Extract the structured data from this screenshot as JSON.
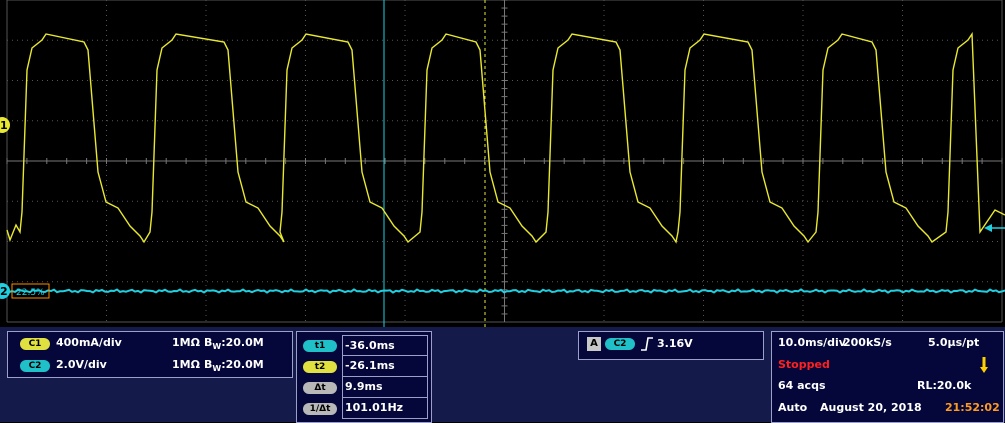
{
  "colors": {
    "ch1": "#e8e830",
    "ch2": "#20d0e0",
    "grid": "#555555",
    "trigger_marker": "#ff8c00",
    "stopped": "#ff2020",
    "time": "#ff9a20"
  },
  "channels": [
    {
      "badge": "C1",
      "scale": "400mA/div",
      "impedance": "1MΩ",
      "bw_prefix": "B",
      "bw_sub": "W",
      "bw_value": ":20.0M"
    },
    {
      "badge": "C2",
      "scale": "2.0V/div",
      "impedance": "1MΩ",
      "bw_prefix": "B",
      "bw_sub": "W",
      "bw_value": ":20.0M"
    }
  ],
  "cursors": [
    {
      "label": "t1",
      "value": "-36.0ms",
      "badge_color": "#20c0c8"
    },
    {
      "label": "t2",
      "value": "-26.1ms",
      "badge_color": "#e0e040"
    },
    {
      "label": "Δt",
      "value": "9.9ms",
      "badge_color": "#b8b8b8"
    },
    {
      "label": "1/Δt",
      "value": "101.01Hz",
      "badge_color": "#b8b8b8"
    }
  ],
  "trigger": {
    "mode_badge": "A",
    "source": "C2",
    "slope_icon": "rising-edge-icon",
    "level": "3.16V"
  },
  "acquisition": {
    "timebase": "10.0ms/div",
    "sample_rate": "200kS/s",
    "resolution": "5.0μs/pt",
    "state": "Stopped",
    "acqs": "64 acqs",
    "record_length": "RL:20.0k",
    "trigger_mode": "Auto",
    "date": "August 20, 2018",
    "time": "21:52:02"
  },
  "markers": {
    "ch1_marker": "1",
    "ch2_marker": "2",
    "ch2_offset_label": "22.5%"
  }
}
